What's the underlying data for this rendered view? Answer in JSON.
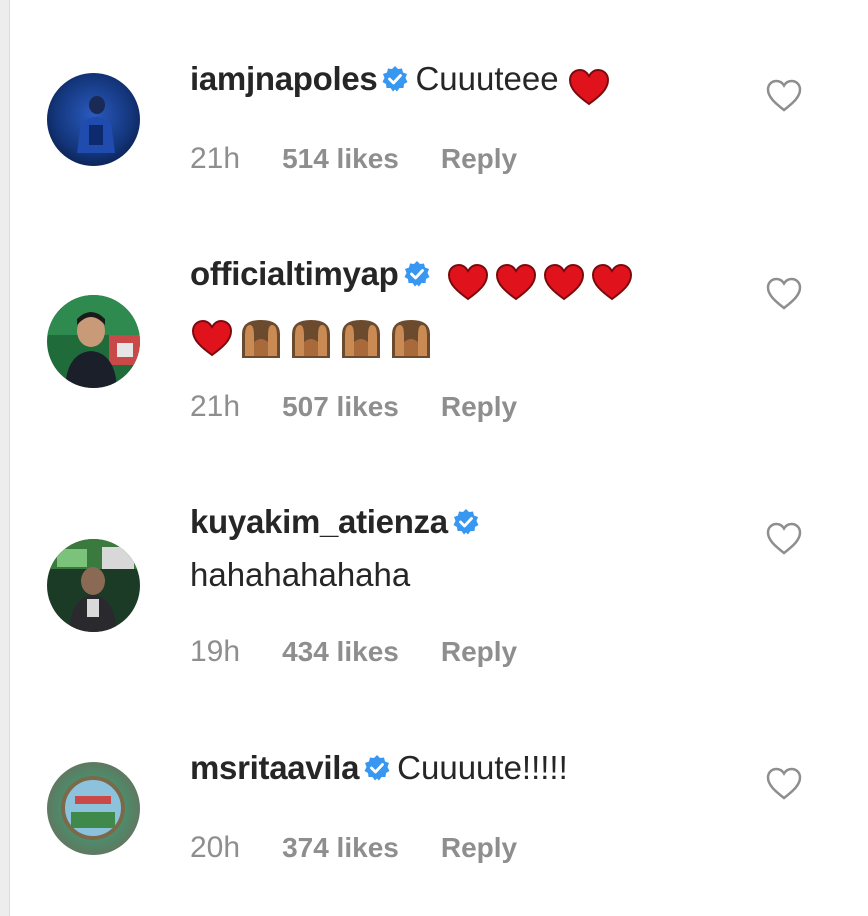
{
  "comments": [
    {
      "username": "iamjnapoles",
      "verified": true,
      "text": "Cuuuteee",
      "emoji_line1": [
        "heart"
      ],
      "emoji_line2": [],
      "time": "21h",
      "likes": "514 likes",
      "reply": "Reply",
      "avatar_icon": "avatar-photo"
    },
    {
      "username": "officialtimyap",
      "verified": true,
      "text": "",
      "emoji_line1": [
        "heart",
        "heart",
        "heart",
        "heart"
      ],
      "emoji_line2": [
        "heart",
        "person-raising-hands",
        "person-raising-hands",
        "person-raising-hands",
        "person-raising-hands"
      ],
      "time": "21h",
      "likes": "507 likes",
      "reply": "Reply",
      "avatar_icon": "avatar-photo"
    },
    {
      "username": "kuyakim_atienza",
      "verified": true,
      "text": "hahahahahaha",
      "emoji_line1": [],
      "emoji_line2": [],
      "time": "19h",
      "likes": "434 likes",
      "reply": "Reply",
      "avatar_icon": "avatar-photo"
    },
    {
      "username": "msritaavila",
      "verified": true,
      "text": "Cuuuute!!!!!",
      "emoji_line1": [],
      "emoji_line2": [],
      "time": "20h",
      "likes": "374 likes",
      "reply": "Reply",
      "avatar_icon": "avatar-photo"
    }
  ],
  "colors": {
    "text": "#262626",
    "meta": "#8e8e8e",
    "verified": "#3897f0",
    "heart_emoji": "#e0131c"
  }
}
